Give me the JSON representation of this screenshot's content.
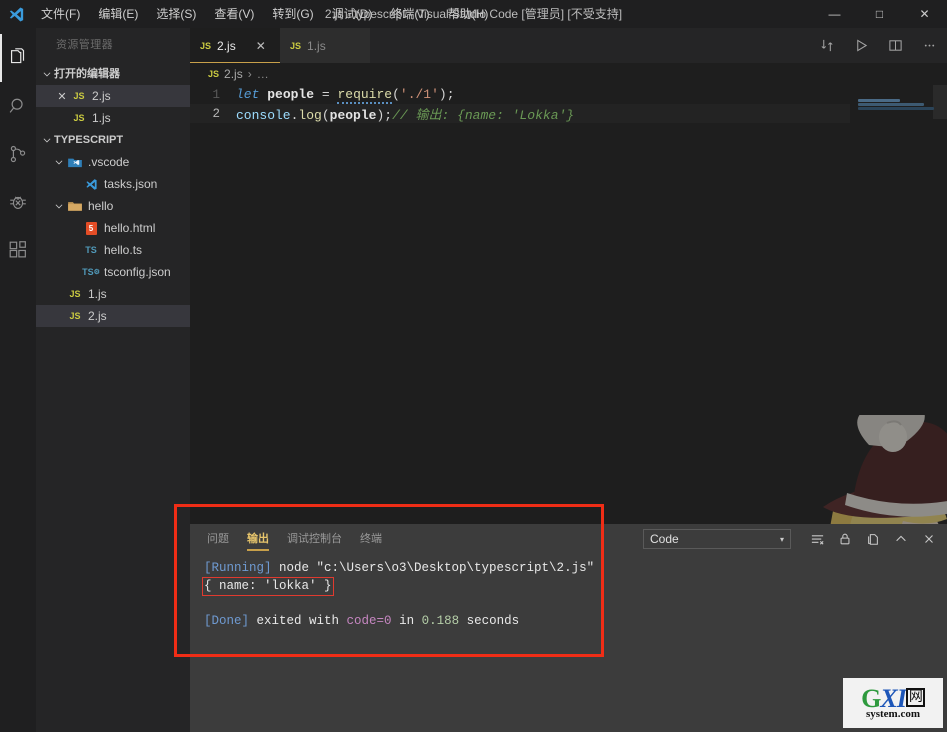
{
  "titlebar": {
    "title": "2.js - typescript - Visual Studio Code [管理员] [不受支持]",
    "menus": [
      {
        "label": "文件(F)"
      },
      {
        "label": "编辑(E)"
      },
      {
        "label": "选择(S)"
      },
      {
        "label": "查看(V)"
      },
      {
        "label": "转到(G)"
      },
      {
        "label": "调试(D)"
      },
      {
        "label": "终端(T)"
      },
      {
        "label": "帮助(H)"
      }
    ],
    "minimize": "—",
    "maximize": "□",
    "close": "✕"
  },
  "activitybar": {
    "items": [
      {
        "name": "explorer-icon",
        "title": "资源管理器"
      },
      {
        "name": "search-icon",
        "title": "搜索"
      },
      {
        "name": "source-control-icon",
        "title": "源代码管理"
      },
      {
        "name": "debug-icon",
        "title": "调试"
      },
      {
        "name": "extensions-icon",
        "title": "扩展"
      }
    ]
  },
  "sidebar": {
    "title": "资源管理器",
    "open_editors": {
      "label": "打开的编辑器",
      "items": [
        {
          "name": "2.js",
          "badge": "JS",
          "selected": true,
          "closable": true
        },
        {
          "name": "1.js",
          "badge": "JS",
          "selected": false,
          "closable": false
        }
      ]
    },
    "project": {
      "label": "TYPESCRIPT",
      "items": [
        {
          "name": ".vscode",
          "kind": "folder-vscode",
          "depth": 1,
          "expanded": true
        },
        {
          "name": "tasks.json",
          "kind": "vscode-file",
          "depth": 2
        },
        {
          "name": "hello",
          "kind": "folder",
          "depth": 1,
          "expanded": true
        },
        {
          "name": "hello.html",
          "kind": "html",
          "depth": 2
        },
        {
          "name": "hello.ts",
          "kind": "ts",
          "depth": 2
        },
        {
          "name": "tsconfig.json",
          "kind": "tsconfig",
          "depth": 2
        },
        {
          "name": "1.js",
          "kind": "js",
          "depth": 1
        },
        {
          "name": "2.js",
          "kind": "js",
          "depth": 1,
          "selected": true
        }
      ]
    }
  },
  "editor": {
    "tabs": [
      {
        "label": "2.js",
        "badge": "JS",
        "active": true
      },
      {
        "label": "1.js",
        "badge": "JS",
        "active": false
      }
    ],
    "tab_close": "✕",
    "actions": [
      {
        "name": "split-changes-icon"
      },
      {
        "name": "run-icon"
      },
      {
        "name": "split-editor-icon"
      },
      {
        "name": "more-actions-icon"
      }
    ],
    "breadcrumb": {
      "badge": "JS",
      "file": "2.js",
      "separator": "›",
      "more": "…"
    },
    "lines": [
      {
        "number": "1",
        "current": false
      },
      {
        "number": "2",
        "current": true
      }
    ],
    "code": {
      "line1": {
        "kw": "let",
        "var": "people",
        "eq": "=",
        "fn": "require",
        "open": "(",
        "str": "'./1'",
        "close": ")",
        "semi": ";"
      },
      "line2": {
        "obj": "console",
        "dot": ".",
        "method": "log",
        "open": "(",
        "arg": "people",
        "close": ")",
        "semi": ";",
        "comment": "// 输出: {name: 'Lokka'}"
      }
    }
  },
  "panel": {
    "tabs": [
      {
        "label": "问题",
        "active": false
      },
      {
        "label": "输出",
        "active": true
      },
      {
        "label": "调试控制台",
        "active": false
      },
      {
        "label": "终端",
        "active": false
      }
    ],
    "channel": {
      "value": "Code",
      "arrow": "▾"
    },
    "actions": [
      {
        "name": "clear-output-icon"
      },
      {
        "name": "lock-icon"
      },
      {
        "name": "open-in-editor-icon"
      },
      {
        "name": "collapse-panel-icon"
      },
      {
        "name": "close-panel-icon"
      }
    ],
    "output": {
      "running_tag": "[Running]",
      "running_cmd": " node \"c:\\Users\\o3\\Desktop\\typescript\\2.js\"",
      "result": "{ name: 'lokka' }",
      "done_tag": "[Done]",
      "done_mid": " exited with ",
      "done_code": "code=0",
      "done_in": " in ",
      "done_secs": "0.188",
      "done_unit": " seconds"
    }
  },
  "watermark": {
    "g": "G",
    "xi": "XI",
    "box": "网",
    "bottom": "system.com"
  },
  "colors": {
    "accent": "#c8a04a",
    "annotation": "#f02d16",
    "panel_bg": "#3c3c3c",
    "editor_bg": "#1e1e1e",
    "sidebar_bg": "#252526"
  }
}
